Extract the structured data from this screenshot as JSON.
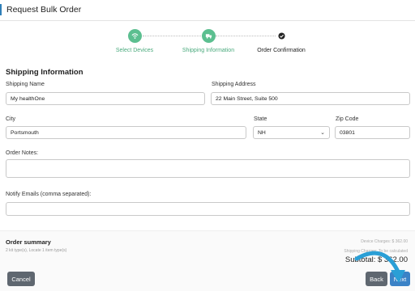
{
  "header": {
    "title": "Request Bulk Order"
  },
  "stepper": {
    "steps": [
      {
        "label": "Select Devices",
        "icon": "wifi-icon",
        "state": "done"
      },
      {
        "label": "Shipping Information",
        "icon": "truck-icon",
        "state": "done"
      },
      {
        "label": "Order Confirmation",
        "icon": "check-circle-icon",
        "state": "current"
      }
    ]
  },
  "shipping": {
    "title": "Shipping Information",
    "shipping_name": {
      "label": "Shipping Name",
      "value": "My healthOne"
    },
    "shipping_address": {
      "label": "Shipping Address",
      "value": "22 Main Street, Suite 500"
    },
    "city": {
      "label": "City",
      "value": "Portsmouth"
    },
    "state": {
      "label": "State",
      "value": "NH"
    },
    "zip": {
      "label": "Zip Code",
      "value": "03801"
    },
    "order_notes": {
      "label": "Order Notes:",
      "value": ""
    },
    "notify_emails": {
      "label": "Notify Emails (comma separated):",
      "value": ""
    }
  },
  "summary": {
    "title": "Order summary",
    "subtitle": "2 kit type(s), Locate 1 item type(s)",
    "device_charges": "Device Charges: $ 362.00",
    "shipping_charges": "Shipping Charges: To be calculated",
    "subtotal": "Subtotal: $ 362.00"
  },
  "buttons": {
    "cancel": "Cancel",
    "back": "Back",
    "next": "Next"
  },
  "colors": {
    "accent_green": "#5cbf90",
    "primary_blue": "#3b82c6",
    "neutral_button": "#5f6770"
  }
}
